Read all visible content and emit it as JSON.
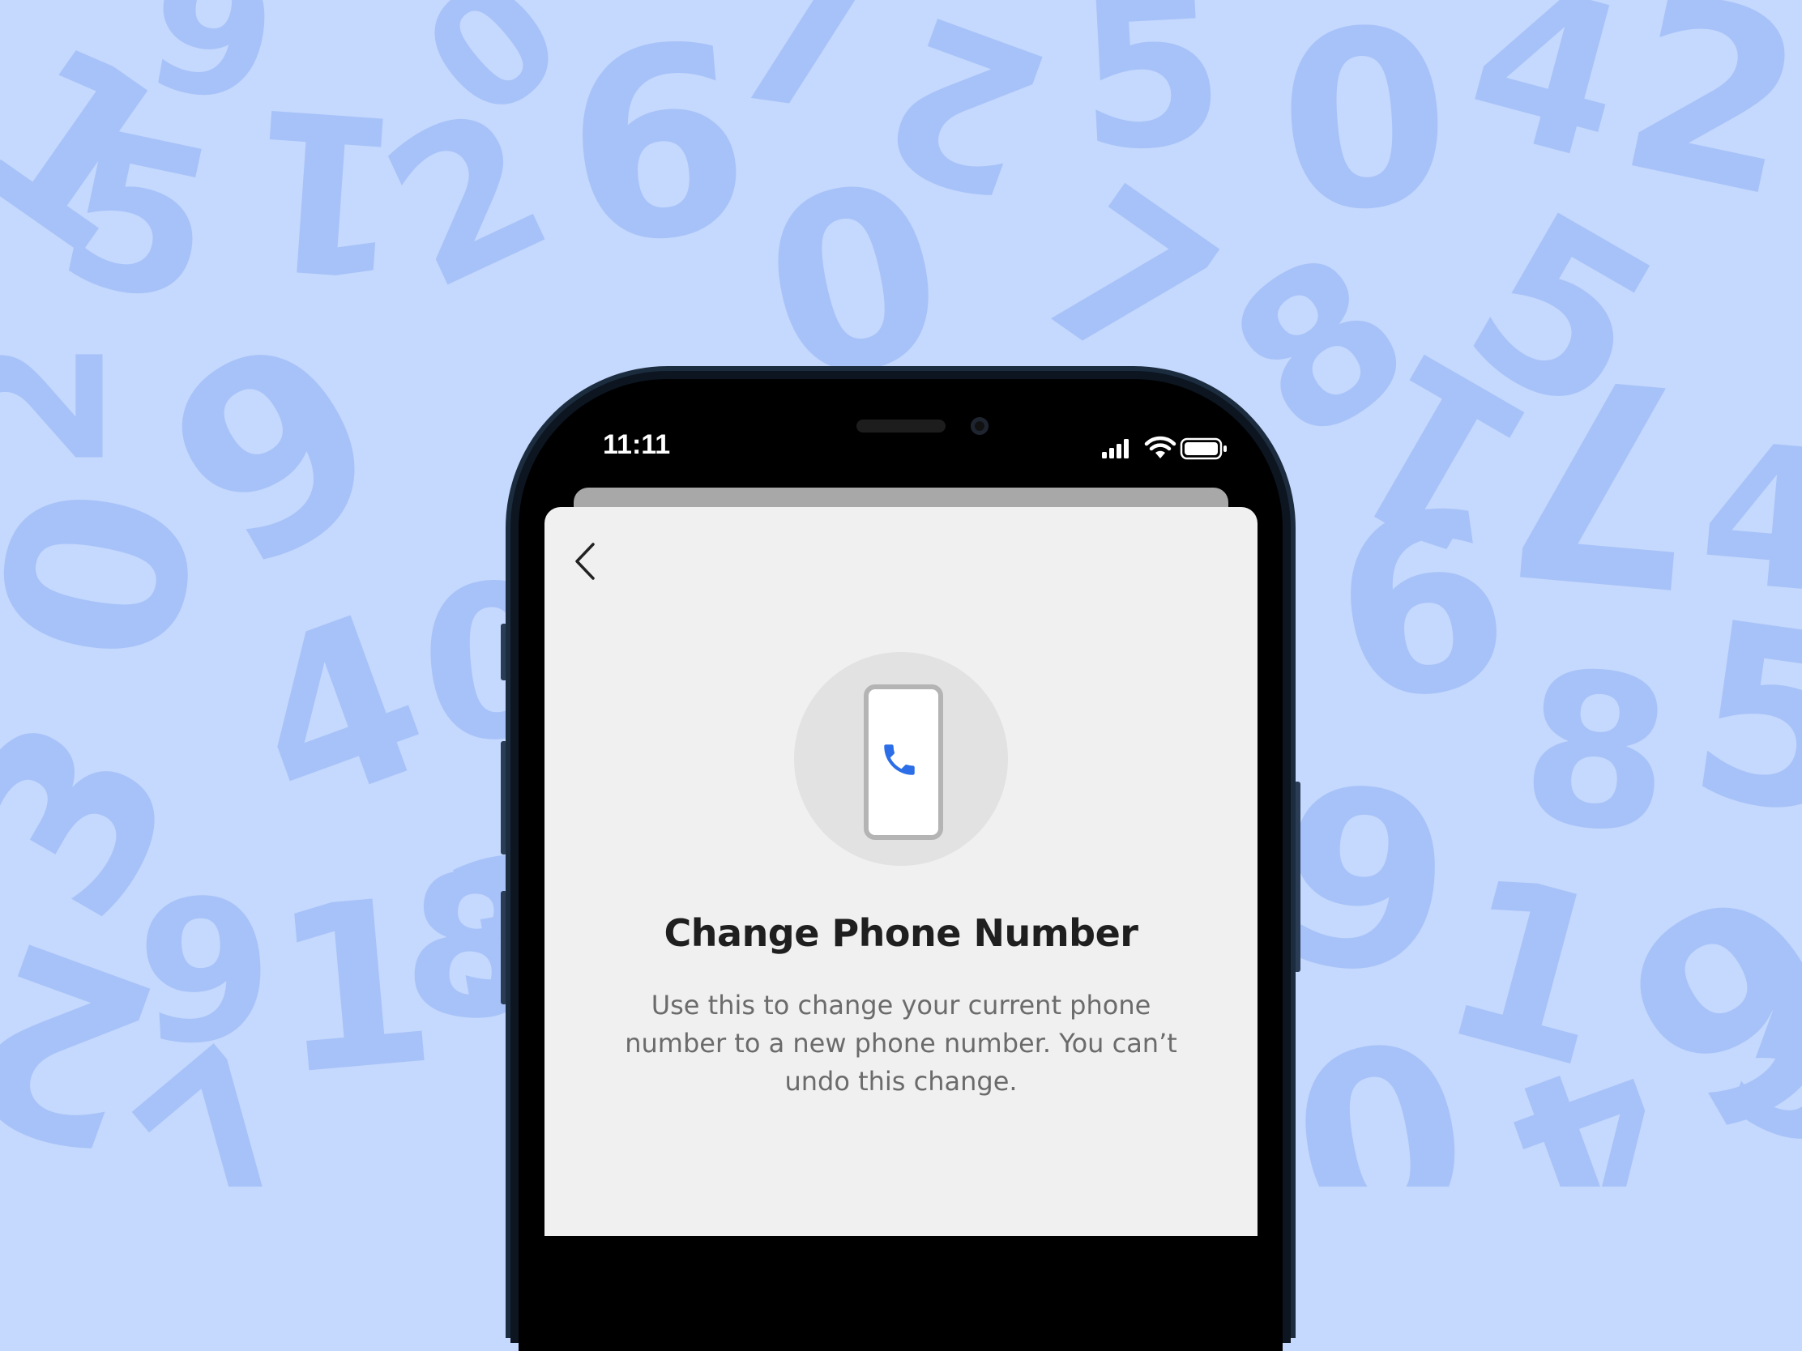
{
  "background": {
    "color": "#c5d8fd",
    "digit_color": "#a6c2f8",
    "digits": [
      "1",
      "5",
      "1",
      "9",
      "2",
      "6",
      "7",
      "0",
      "2",
      "5",
      "0",
      "4",
      "2",
      "8",
      "5",
      "7",
      "9",
      "0",
      "3",
      "4",
      "0",
      "7",
      "6",
      "8",
      "9",
      "1",
      "5",
      "0",
      "4",
      "9",
      "3",
      "2",
      "9",
      "1",
      "8",
      "1",
      "2",
      "0",
      "4",
      "7",
      "5"
    ]
  },
  "status_bar": {
    "time": "11:11",
    "signal_icon": "cellular-signal-icon",
    "wifi_icon": "wifi-icon",
    "battery_icon": "battery-icon"
  },
  "screen": {
    "back_icon": "chevron-left-icon",
    "hero_icon": "phone-call-icon",
    "accent_color": "#2b6ee8",
    "title": "Change Phone Number",
    "description_lines": [
      "Use this to change your current phone",
      "number to a new phone number. You can’t",
      "undo this change."
    ]
  }
}
